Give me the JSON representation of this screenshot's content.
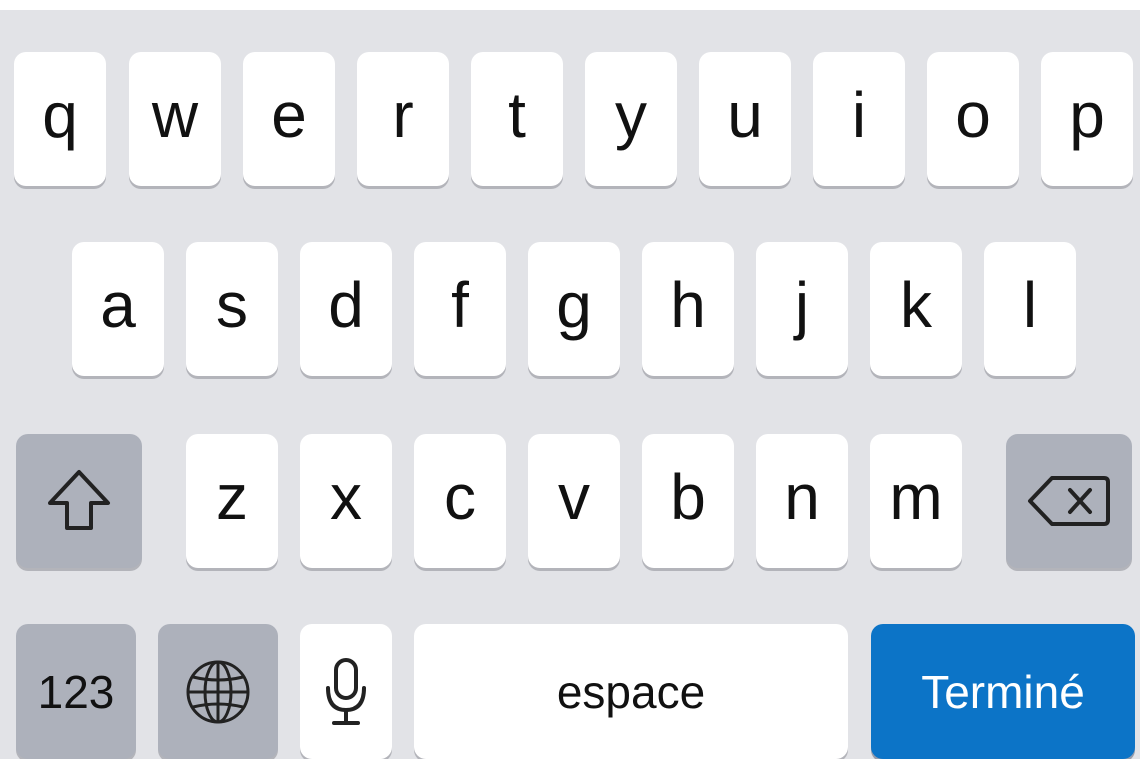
{
  "keyboard": {
    "row1": [
      "q",
      "w",
      "e",
      "r",
      "t",
      "y",
      "u",
      "i",
      "o",
      "p"
    ],
    "row2": [
      "a",
      "s",
      "d",
      "f",
      "g",
      "h",
      "j",
      "k",
      "l"
    ],
    "row3": [
      "z",
      "x",
      "c",
      "v",
      "b",
      "n",
      "m"
    ],
    "shift_icon": "shift-arrow-icon",
    "delete_icon": "backspace-icon",
    "numbers_label": "123",
    "globe_icon": "globe-icon",
    "mic_icon": "microphone-icon",
    "space_label": "espace",
    "return_label": "Terminé",
    "colors": {
      "background": "#e2e3e7",
      "key": "#ffffff",
      "modifier_key": "#adb1bb",
      "return_key": "#0c74c7",
      "key_text": "#111111",
      "return_text": "#ffffff"
    }
  }
}
